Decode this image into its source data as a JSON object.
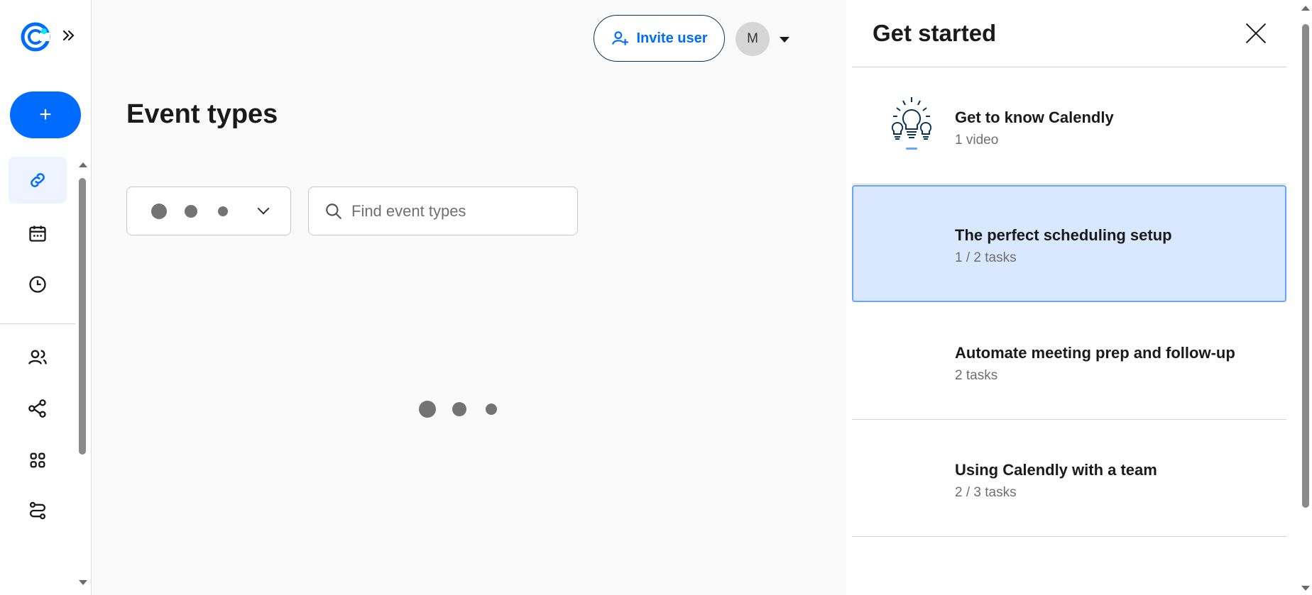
{
  "app": {
    "brand_color": "#006bff",
    "logo_icon": "calendly-logo-icon"
  },
  "sidebar": {
    "expand_icon": "chevrons-right-icon",
    "create_label": "+",
    "items": [
      {
        "name": "scheduling",
        "icon": "link-icon",
        "active": true
      },
      {
        "name": "meetings",
        "icon": "calendar-icon",
        "active": false
      },
      {
        "name": "availability",
        "icon": "clock-icon",
        "active": false
      },
      {
        "name": "contacts",
        "icon": "users-icon",
        "active": false
      },
      {
        "name": "workflows",
        "icon": "workflow-icon",
        "active": false
      },
      {
        "name": "integrations",
        "icon": "apps-grid-icon",
        "active": false
      },
      {
        "name": "routing",
        "icon": "routing-icon",
        "active": false
      }
    ]
  },
  "header": {
    "invite_label": "Invite user",
    "avatar_initial": "M"
  },
  "main": {
    "title": "Event types",
    "search": {
      "placeholder": "Find event types",
      "value": ""
    }
  },
  "panel": {
    "title": "Get started",
    "cards": [
      {
        "title": "Get to know Calendly",
        "subtitle": "1 video",
        "icon": "lightbulb-icon",
        "selected": false
      },
      {
        "title": "The perfect scheduling setup",
        "subtitle": "1 / 2 tasks",
        "selected": true
      },
      {
        "title": "Automate meeting prep and follow-up",
        "subtitle": "2 tasks",
        "selected": false
      },
      {
        "title": "Using Calendly with a team",
        "subtitle": "2 / 3 tasks",
        "selected": false
      }
    ]
  }
}
